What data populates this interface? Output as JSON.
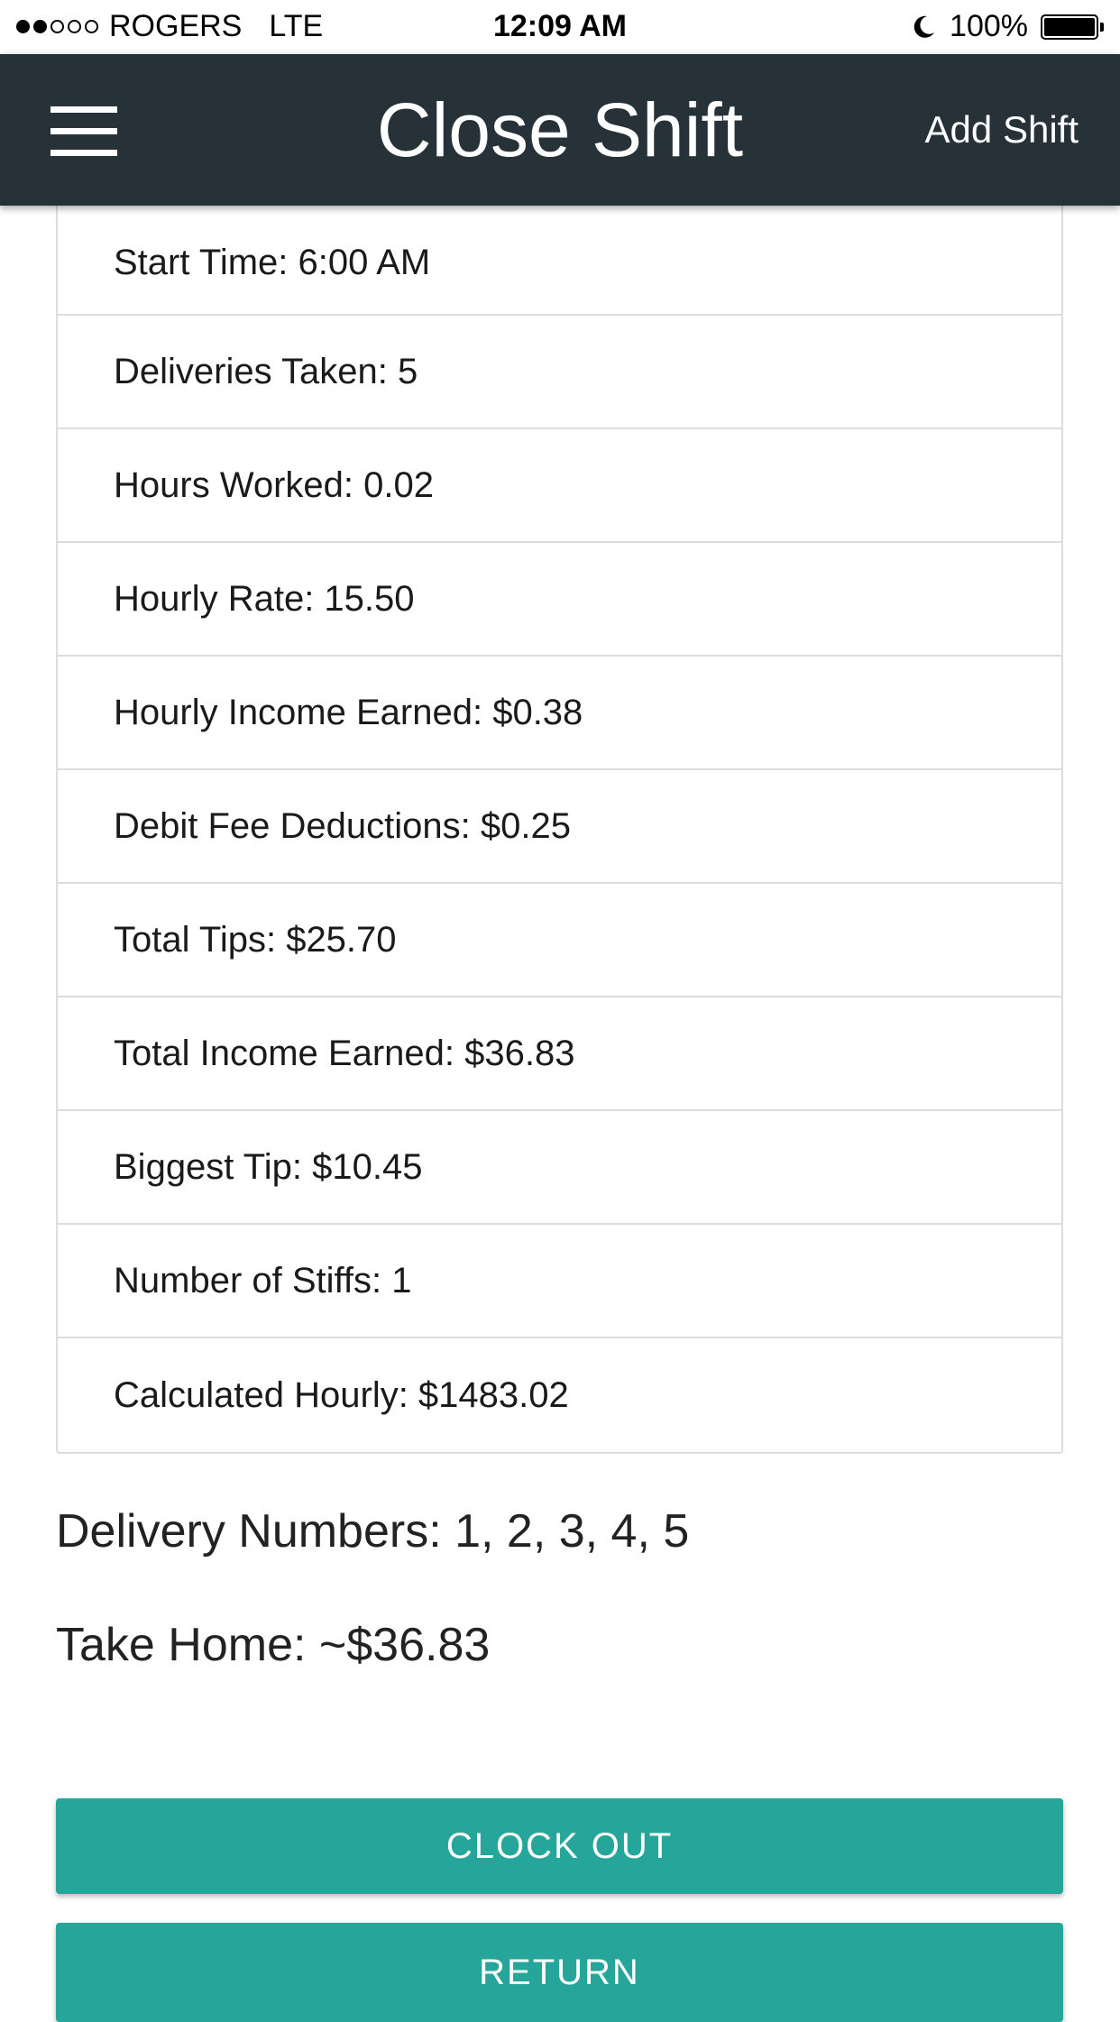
{
  "status_bar": {
    "carrier": "ROGERS",
    "network": "LTE",
    "time": "12:09 AM",
    "battery": "100%",
    "signal_strength": 2,
    "signal_total": 5,
    "icons": [
      "signal-dots-icon",
      "moon-icon",
      "battery-icon"
    ]
  },
  "header": {
    "title": "Close Shift",
    "add_shift_label": "Add Shift",
    "menu_icon": "hamburger-menu-icon",
    "background": "#263238"
  },
  "summary_items": [
    {
      "label": "Start Time: 6:00 AM"
    },
    {
      "label": "Deliveries Taken: 5"
    },
    {
      "label": "Hours Worked: 0.02"
    },
    {
      "label": "Hourly Rate: 15.50"
    },
    {
      "label": "Hourly Income Earned: $0.38"
    },
    {
      "label": "Debit Fee Deductions: $0.25"
    },
    {
      "label": "Total Tips: $25.70"
    },
    {
      "label": "Total Income Earned: $36.83"
    },
    {
      "label": "Biggest Tip: $10.45"
    },
    {
      "label": "Number of Stiffs: 1"
    },
    {
      "label": "Calculated Hourly: $1483.02"
    }
  ],
  "delivery_numbers": "Delivery Numbers: 1, 2, 3, 4, 5",
  "take_home": "Take Home: ~$36.83",
  "buttons": {
    "clock_out": "CLOCK OUT",
    "return": "RETURN"
  },
  "colors": {
    "accent": "#26a69a",
    "header": "#263238",
    "divider": "#dddddd"
  }
}
